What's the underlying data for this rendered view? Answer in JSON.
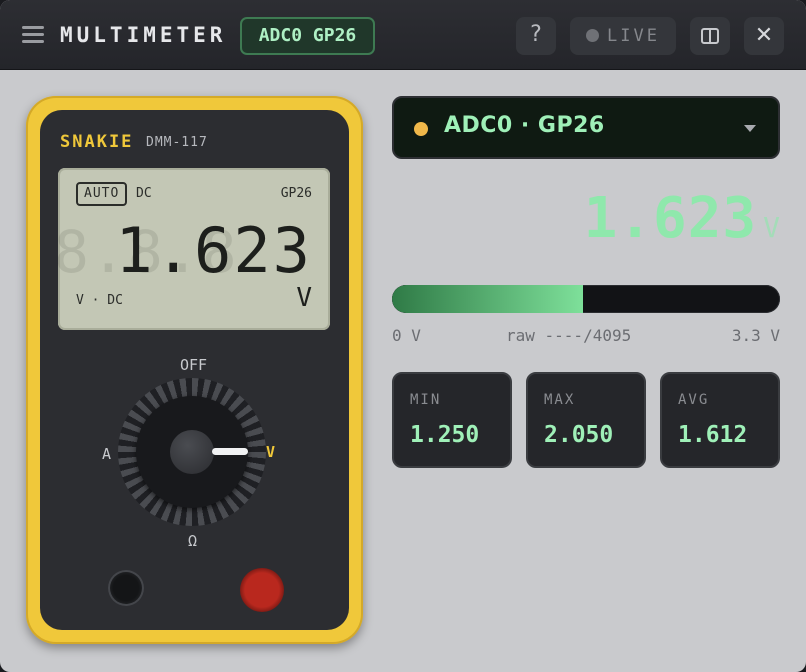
{
  "titlebar": {
    "app_title": "MULTIMETER",
    "channel_chip": "ADC0 GP26",
    "help_label": "?",
    "live_label": "LIVE",
    "close_label": "✕"
  },
  "device": {
    "brand": "SNAKIE",
    "model": "DMM-117",
    "lcd": {
      "auto_badge": "AUTO",
      "coupling": "DC",
      "pin": "GP26",
      "ghost_digits": "8.8.8",
      "value": "1.623",
      "mode": "V · DC",
      "unit": "V"
    },
    "dial": {
      "off_label": "OFF",
      "amp_label": "A",
      "volt_label": "V",
      "ohm_label": "Ω",
      "selected": "V"
    }
  },
  "channel_select": {
    "label": "ADC0 · GP26"
  },
  "reading": {
    "value": "1.623",
    "unit": "V",
    "level_fraction": 0.492
  },
  "scale": {
    "min_label": "0 V",
    "raw_label": "raw ----/4095",
    "max_label": "3.3 V"
  },
  "stats": [
    {
      "label": "MIN",
      "value": "1.250"
    },
    {
      "label": "MAX",
      "value": "2.050"
    },
    {
      "label": "AVG",
      "value": "1.612"
    }
  ],
  "colors": {
    "accent_green": "#9ff0b8",
    "device_yellow": "#f0c83a",
    "indicator_amber": "#f0b84a"
  }
}
